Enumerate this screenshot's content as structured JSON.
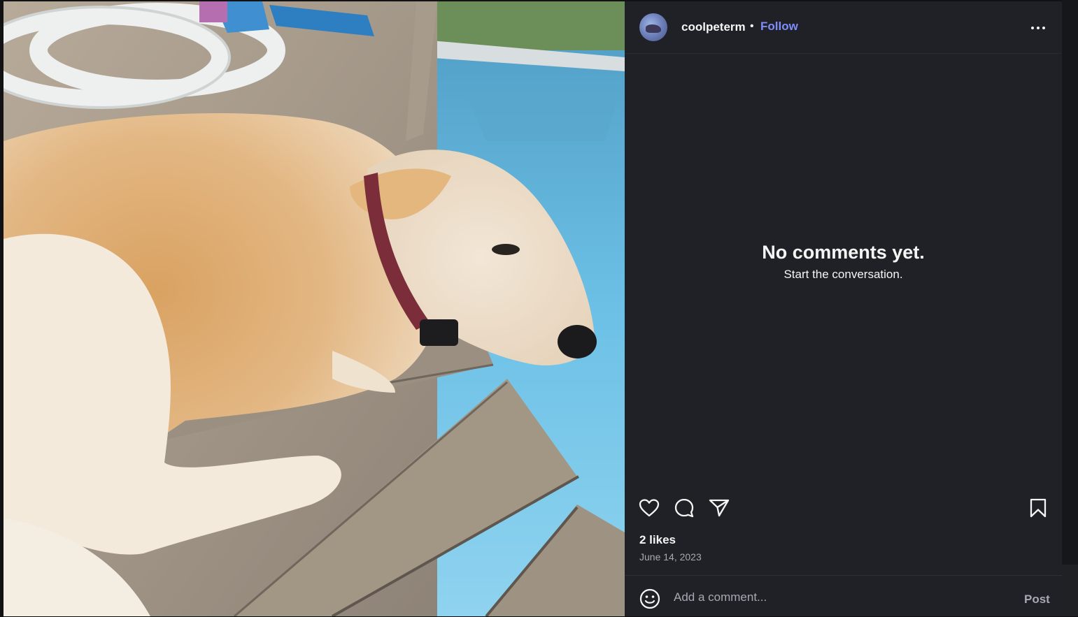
{
  "post": {
    "image_alt": "Dog lying on a wooden pool deck",
    "username": "coolpeterm",
    "separator": "•",
    "follow_label": "Follow",
    "more_icon": "more-horizontal-icon"
  },
  "comments": {
    "empty_title": "No comments yet.",
    "empty_subtitle": "Start the conversation."
  },
  "actions": {
    "like_icon": "heart-icon",
    "comment_icon": "comment-bubble-icon",
    "share_icon": "paper-plane-icon",
    "save_icon": "bookmark-icon"
  },
  "stats": {
    "likes": "2 likes",
    "date": "June 14, 2023"
  },
  "composer": {
    "emoji_icon": "smiley-icon",
    "placeholder": "Add a comment...",
    "post_label": "Post"
  },
  "colors": {
    "panel_bg": "#202126",
    "follow_accent": "#7d8dfb",
    "muted_text": "#a8a8b3"
  }
}
